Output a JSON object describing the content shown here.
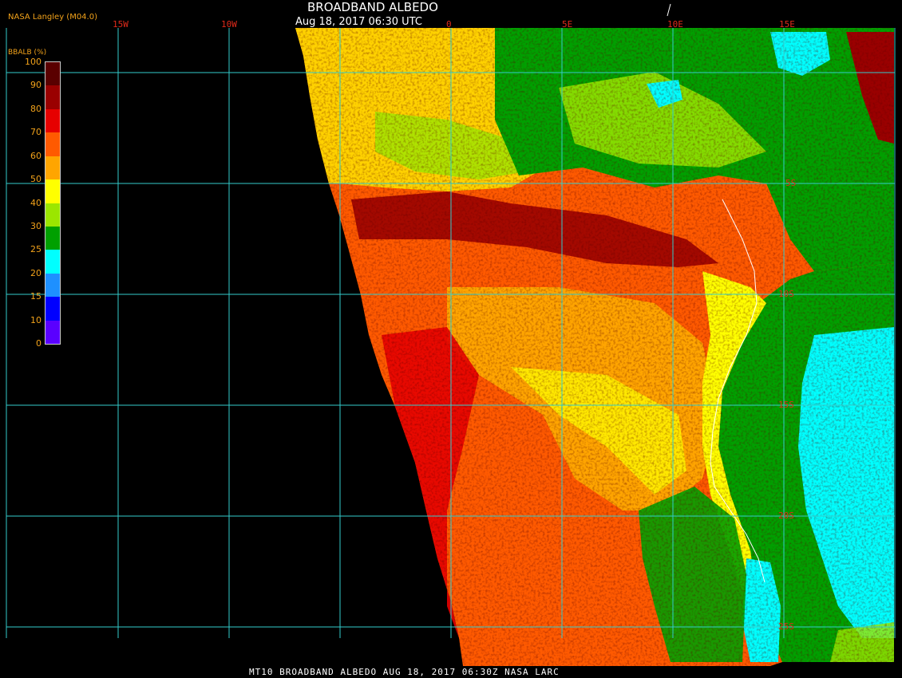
{
  "header": {
    "title": "BROADBAND ALBEDO",
    "subtitle": "Aug 18, 2017 06:30 UTC",
    "org": "NASA Langley (M04.0)"
  },
  "legend": {
    "title": "BBALB (%)",
    "ticks": [
      "100",
      "90",
      "80",
      "70",
      "60",
      "50",
      "40",
      "30",
      "25",
      "20",
      "15",
      "10",
      "0"
    ],
    "colors": [
      "#5a0000",
      "#9a0000",
      "#e60000",
      "#ff5a00",
      "#ffa500",
      "#ffff00",
      "#9be600",
      "#00a000",
      "#00ffff",
      "#1e90ff",
      "#0000ff",
      "#5a00ff"
    ]
  },
  "map": {
    "lon_labels": [
      "15W",
      "10W",
      "0",
      "5E",
      "10E",
      "15E"
    ],
    "lat_labels": [
      "5S",
      "10S",
      "15S",
      "20S",
      "25S"
    ]
  },
  "footer": {
    "text": "MT10  BROADBAND ALBEDO   AUG 18, 2017 06:30Z   NASA LARC"
  },
  "colors": {
    "grid": "#33cccc",
    "label_orange": "#f2a21a",
    "label_red": "#e02a1a"
  }
}
